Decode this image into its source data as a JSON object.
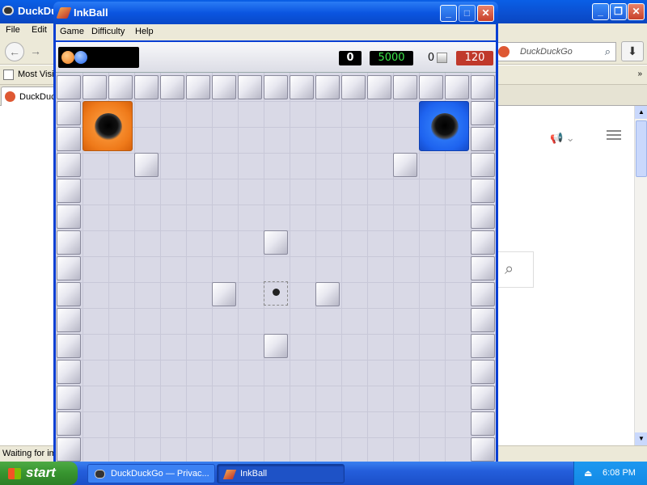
{
  "browser": {
    "title": "DuckDuc",
    "menu": [
      "File",
      "Edit"
    ],
    "search_placeholder": "DuckDuckGo",
    "bookmark_label": "Most Visit",
    "tab_label": "DuckDuc",
    "status_text": "Waiting for im"
  },
  "inkball": {
    "title": "InkBall",
    "menu": [
      "Game",
      "Difficulty",
      "Help"
    ],
    "score": "0",
    "target_score": "5000",
    "ball_count": "0",
    "timer": "120",
    "colors": {
      "orange": "#ef7a1a",
      "blue": "#1e63ef"
    }
  },
  "taskbar": {
    "start_label": "start",
    "tasks": [
      "DuckDuckGo — Privac...",
      "InkBall"
    ],
    "clock": "6:08 PM"
  }
}
